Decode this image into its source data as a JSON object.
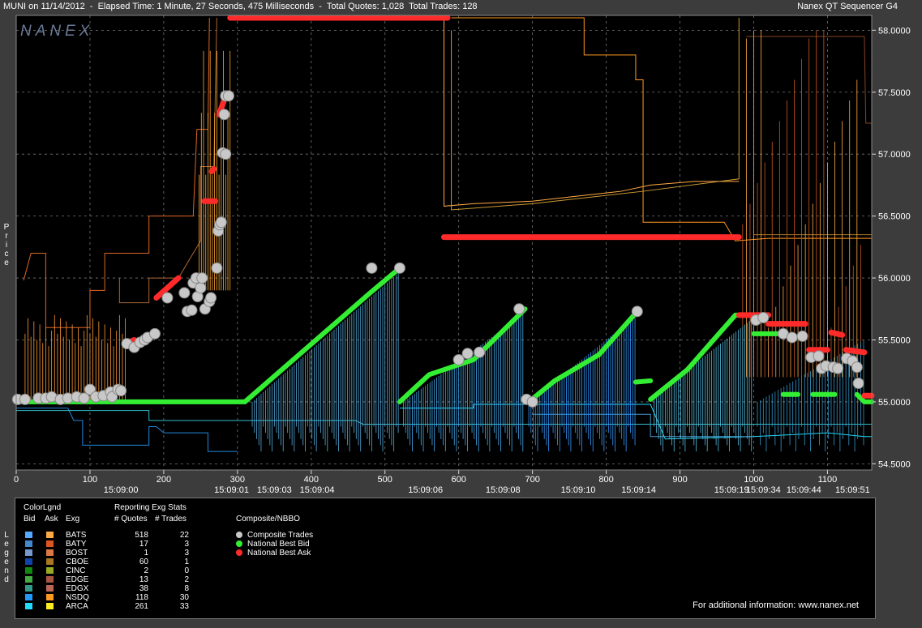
{
  "header": {
    "title": "MUNI on 11/14/2012  -  Elapsed Time: 1 Minute, 27 Seconds, 475 Milliseconds  -  Total Quotes: 1,028  Total Trades: 128",
    "app_name": "Nanex QT Sequencer G4",
    "logo": "NANEX"
  },
  "side_labels": {
    "price": "Price",
    "legend": "Legend"
  },
  "chart_data": {
    "type": "line",
    "xlim": [
      0,
      1160
    ],
    "ylim": [
      54.45,
      58.12
    ],
    "x_ticks": [
      0,
      100,
      200,
      300,
      400,
      500,
      600,
      700,
      800,
      900,
      1000,
      1100
    ],
    "y_ticks": [
      54.5,
      55.0,
      55.5,
      56.0,
      56.5,
      57.0,
      57.5,
      58.0
    ],
    "y_tick_labels": [
      "54.5000",
      "55.0000",
      "55.5000",
      "56.0000",
      "56.5000",
      "57.0000",
      "57.5000",
      "58.0000"
    ],
    "time_labels": [
      {
        "x": 142,
        "label": "15:09:00"
      },
      {
        "x": 292,
        "label": "15:09:01"
      },
      {
        "x": 350,
        "label": "15:09:03"
      },
      {
        "x": 408,
        "label": "15:09:04"
      },
      {
        "x": 555,
        "label": "15:09:06"
      },
      {
        "x": 660,
        "label": "15:09:08"
      },
      {
        "x": 762,
        "label": "15:09:10"
      },
      {
        "x": 844,
        "label": "15:09:14"
      },
      {
        "x": 970,
        "label": "15:09:19"
      },
      {
        "x": 1013,
        "label": "15:09:34"
      },
      {
        "x": 1068,
        "label": "15:09:44"
      },
      {
        "x": 1134,
        "label": "15:09:51"
      }
    ],
    "series": [
      {
        "name": "Composite Trades",
        "kind": "trade",
        "color": "#c8c8c8",
        "points": [
          [
            2,
            55.02
          ],
          [
            12,
            55.02
          ],
          [
            30,
            55.03
          ],
          [
            40,
            55.03
          ],
          [
            48,
            55.04
          ],
          [
            60,
            55.02
          ],
          [
            70,
            55.03
          ],
          [
            82,
            55.04
          ],
          [
            92,
            55.03
          ],
          [
            100,
            55.1
          ],
          [
            108,
            55.04
          ],
          [
            118,
            55.05
          ],
          [
            128,
            55.08
          ],
          [
            130,
            55.04
          ],
          [
            138,
            55.1
          ],
          [
            142,
            55.09
          ],
          [
            150,
            55.47
          ],
          [
            160,
            55.44
          ],
          [
            168,
            55.48
          ],
          [
            174,
            55.5
          ],
          [
            178,
            55.52
          ],
          [
            188,
            55.55
          ],
          [
            205,
            55.84
          ],
          [
            228,
            55.88
          ],
          [
            232,
            55.73
          ],
          [
            238,
            55.74
          ],
          [
            240,
            55.96
          ],
          [
            244,
            56.0
          ],
          [
            246,
            55.85
          ],
          [
            250,
            55.92
          ],
          [
            252,
            56.0
          ],
          [
            256,
            55.75
          ],
          [
            262,
            55.81
          ],
          [
            264,
            55.84
          ],
          [
            272,
            56.08
          ],
          [
            274,
            56.38
          ],
          [
            276,
            56.43
          ],
          [
            278,
            56.45
          ],
          [
            280,
            57.01
          ],
          [
            282,
            57.32
          ],
          [
            284,
            57.0
          ],
          [
            284,
            57.47
          ],
          [
            288,
            57.47
          ],
          [
            482,
            56.08
          ],
          [
            520,
            56.08
          ],
          [
            600,
            55.34
          ],
          [
            612,
            55.39
          ],
          [
            628,
            55.4
          ],
          [
            682,
            55.75
          ],
          [
            692,
            55.02
          ],
          [
            700,
            55.0
          ],
          [
            842,
            55.73
          ],
          [
            1003,
            55.66
          ],
          [
            1013,
            55.68
          ],
          [
            1040,
            55.55
          ],
          [
            1052,
            55.52
          ],
          [
            1066,
            55.53
          ],
          [
            1078,
            55.36
          ],
          [
            1088,
            55.37
          ],
          [
            1092,
            55.27
          ],
          [
            1098,
            55.29
          ],
          [
            1108,
            55.28
          ],
          [
            1114,
            55.27
          ],
          [
            1126,
            55.35
          ],
          [
            1134,
            55.33
          ],
          [
            1140,
            55.28
          ],
          [
            1142,
            55.15
          ]
        ]
      },
      {
        "name": "National Best Bid",
        "kind": "bid",
        "color": "#33ee33",
        "segments": [
          [
            [
              0,
              55.0
            ],
            [
              310,
              55.0
            ]
          ],
          [
            [
              310,
              55.0
            ],
            [
              480,
              55.88
            ],
            [
              520,
              56.08
            ]
          ],
          [
            [
              520,
              55.0
            ],
            [
              560,
              55.22
            ],
            [
              620,
              55.34
            ],
            [
              690,
              55.75
            ]
          ],
          [
            [
              695,
              55.0
            ],
            [
              730,
              55.17
            ],
            [
              790,
              55.38
            ],
            [
              842,
              55.73
            ]
          ],
          [
            [
              840,
              55.16
            ],
            [
              860,
              55.17
            ]
          ],
          [
            [
              860,
              55.02
            ],
            [
              910,
              55.26
            ],
            [
              975,
              55.7
            ],
            [
              1000,
              55.7
            ]
          ],
          [
            [
              1000,
              55.55
            ],
            [
              1040,
              55.55
            ]
          ],
          [
            [
              1040,
              55.06
            ],
            [
              1060,
              55.06
            ]
          ],
          [
            [
              1080,
              55.06
            ],
            [
              1110,
              55.06
            ]
          ],
          [
            [
              1140,
              55.06
            ],
            [
              1150,
              55.0
            ],
            [
              1160,
              55.0
            ]
          ]
        ]
      },
      {
        "name": "National Best Ask",
        "kind": "ask",
        "color": "#ff2a2a",
        "segments": [
          [
            [
              148,
              55.47
            ],
            [
              160,
              55.5
            ]
          ],
          [
            [
              190,
              55.84
            ],
            [
              220,
              56.0
            ]
          ],
          [
            [
              255,
              56.62
            ],
            [
              270,
              56.62
            ]
          ],
          [
            [
              265,
              56.86
            ],
            [
              268,
              56.88
            ]
          ],
          [
            [
              275,
              57.32
            ],
            [
              284,
              57.47
            ]
          ],
          [
            [
              290,
              58.1
            ],
            [
              585,
              58.1
            ]
          ],
          [
            [
              580,
              56.33
            ],
            [
              980,
              56.33
            ]
          ],
          [
            [
              980,
              55.7
            ],
            [
              1020,
              55.7
            ]
          ],
          [
            [
              1020,
              55.63
            ],
            [
              1070,
              55.63
            ]
          ],
          [
            [
              1075,
              55.42
            ],
            [
              1100,
              55.42
            ]
          ],
          [
            [
              1105,
              55.56
            ],
            [
              1120,
              55.54
            ]
          ],
          [
            [
              1125,
              55.42
            ],
            [
              1150,
              55.4
            ]
          ],
          [
            [
              1150,
              55.05
            ],
            [
              1160,
              55.05
            ]
          ]
        ]
      }
    ]
  },
  "legend": {
    "headers": {
      "color_lgnd": "ColorLgnd",
      "reporting": "Reporting Exg Stats",
      "bid": "Bid",
      "ask": "Ask",
      "exg": "Exg",
      "quotes": "# Quotes",
      "trades": "# Trades",
      "composite": "Composite/NBBO"
    },
    "exchanges": [
      {
        "name": "BATS",
        "quotes": "518",
        "trades": "22",
        "bid_color": "#55aaff",
        "ask_color": "#ffaa44"
      },
      {
        "name": "BATY",
        "quotes": "17",
        "trades": "3",
        "bid_color": "#4488cc",
        "ask_color": "#dd5522"
      },
      {
        "name": "BOST",
        "quotes": "1",
        "trades": "3",
        "bid_color": "#7799cc",
        "ask_color": "#dd7744"
      },
      {
        "name": "CBOE",
        "quotes": "60",
        "trades": "1",
        "bid_color": "#1144aa",
        "ask_color": "#aa7722"
      },
      {
        "name": "CINC",
        "quotes": "2",
        "trades": "0",
        "bid_color": "#118811",
        "ask_color": "#99aa22"
      },
      {
        "name": "EDGE",
        "quotes": "13",
        "trades": "2",
        "bid_color": "#44aa44",
        "ask_color": "#aa5544"
      },
      {
        "name": "EDGX",
        "quotes": "38",
        "trades": "8",
        "bid_color": "#339988",
        "ask_color": "#bb6655"
      },
      {
        "name": "NSDQ",
        "quotes": "118",
        "trades": "30",
        "bid_color": "#2299ff",
        "ask_color": "#ff9922"
      },
      {
        "name": "ARCA",
        "quotes": "261",
        "trades": "33",
        "bid_color": "#22ddff",
        "ask_color": "#ffee22"
      }
    ],
    "composite_items": [
      {
        "label": "Composite Trades",
        "color": "#c8c8c8"
      },
      {
        "label": "National Best Bid",
        "color": "#33ee33"
      },
      {
        "label": "National Best Ask",
        "color": "#ff2a2a"
      }
    ],
    "footer": "For additional information: www.nanex.net"
  }
}
